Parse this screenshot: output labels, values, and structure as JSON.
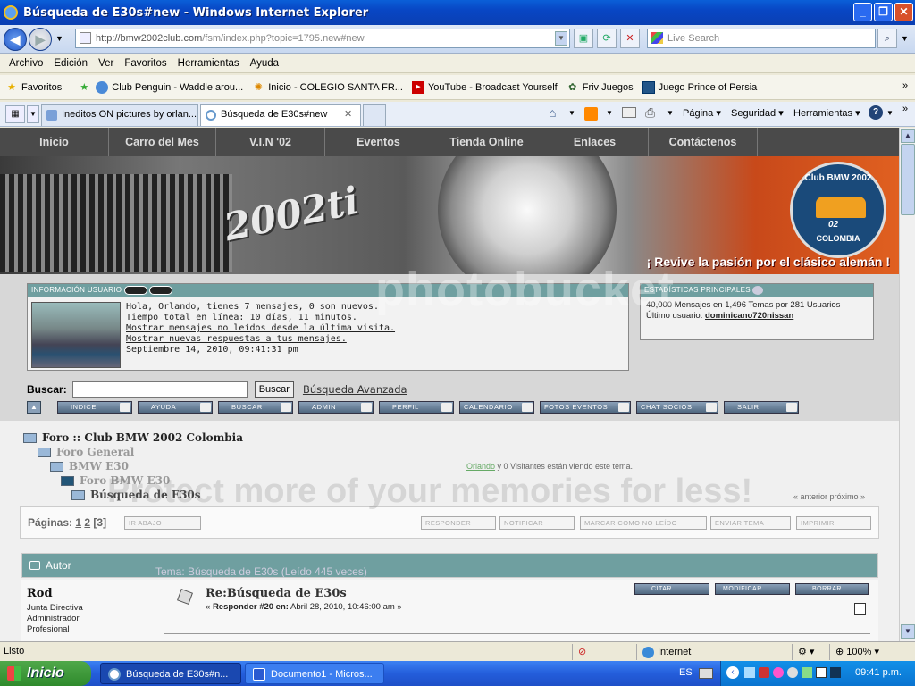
{
  "window": {
    "title": "Búsqueda de E30s#new - Windows Internet Explorer",
    "min": "_",
    "max": "❐",
    "close": "✕"
  },
  "address": {
    "url_prefix": "http://bmw2002club.com",
    "url_path": "/fsm/index.php?topic=1795.new#new",
    "live_search_placeholder": "Live Search"
  },
  "menu": [
    "Archivo",
    "Edición",
    "Ver",
    "Favoritos",
    "Herramientas",
    "Ayuda"
  ],
  "favorites": {
    "label": "Favoritos",
    "items": [
      {
        "label": "Club Penguin - Waddle arou...",
        "icon": "penguin-icon"
      },
      {
        "label": "Inicio - COLEGIO SANTA FR...",
        "icon": "star-icon"
      },
      {
        "label": "YouTube - Broadcast Yourself",
        "icon": "youtube-icon"
      },
      {
        "label": "Friv Juegos",
        "icon": "friv-icon"
      },
      {
        "label": "Juego Prince of Persia",
        "icon": "page-icon"
      }
    ]
  },
  "tabs": [
    {
      "label": "Ineditos ON pictures by orlan..."
    },
    {
      "label": "Búsqueda de E30s#new"
    }
  ],
  "commandbar": [
    "Página",
    "Seguridad",
    "Herramientas"
  ],
  "site_nav": [
    "Inicio",
    "Carro del Mes",
    "V.I.N '02",
    "Eventos",
    "Tienda Online",
    "Enlaces",
    "Contáctenos"
  ],
  "banner": {
    "model": "2002ti",
    "slogan": "¡ Revive la pasión por el clásico alemán !",
    "logo_top": "Club BMW 2002",
    "logo_bottom": "COLOMBIA",
    "logo_badge": "02"
  },
  "user_panel": {
    "header": "INFORMACIÓN USUARIO",
    "line1": "Hola, Orlando, tienes 7 mensajes, 0 son nuevos.",
    "line2": "Tiempo total en línea: 10 días, 11 minutos.",
    "line3": "Mostrar mensajes no leídos desde la última visita.",
    "line4": "Mostrar nuevas respuestas a tus mensajes.",
    "line5": "Septiembre 14, 2010, 09:41:31 pm"
  },
  "stats_panel": {
    "header": "ESTADÍSTICAS PRINCIPALES",
    "line1": "40,000 Mensajes en 1,496 Temas por 281 Usuarios",
    "line2_prefix": "Último usuario:",
    "line2_user": "dominicano720nissan"
  },
  "search": {
    "label": "Buscar:",
    "button": "Buscar",
    "advanced": "Búsqueda Avanzada"
  },
  "action_buttons": [
    "INDICE",
    "AYUDA",
    "BUSCAR",
    "ADMIN",
    "PERFIL",
    "CALENDARIO",
    "FOTOS EVENTOS",
    "CHAT SOCIOS",
    "SALIR"
  ],
  "breadcrumb": [
    "Foro :: Club BMW 2002 Colombia",
    "Foro General",
    "BMW E30",
    "Foro BMW E30",
    "Búsqueda de E30s"
  ],
  "viewing": {
    "user": "Orlando",
    "rest": "y 0 Visitantes están viendo este tema."
  },
  "prev_next": "« anterior próximo »",
  "pages": {
    "label": "Páginas:",
    "p1": "1",
    "p2": "2",
    "current": "[3]",
    "go_down": "IR ABAJO"
  },
  "topic_buttons": [
    "RESPONDER",
    "NOTIFICAR",
    "MARCAR COMO NO LEÍDO",
    "ENVIAR TEMA",
    "IMPRIMIR"
  ],
  "author_bar": {
    "label": "Autor",
    "topic": "Tema: Búsqueda de E30s  (Leído 445 veces)"
  },
  "post": {
    "author": "Rod",
    "roles": [
      "Junta Directiva",
      "Administrador",
      "Profesional"
    ],
    "title": "Re:Búsqueda de E30s",
    "meta_prefix": "« ",
    "meta_bold": "Responder #20 en:",
    "meta_date": " Abril 28, 2010, 10:46:00 am »",
    "buttons": [
      "CITAR",
      "MODIFICAR",
      "BORRAR"
    ]
  },
  "statusbar": {
    "status": "Listo",
    "zone": "Internet",
    "zoom": "100%"
  },
  "taskbar": {
    "start": "Inicio",
    "tasks": [
      "Búsqueda de E30s#n...",
      "Documento1 - Micros..."
    ],
    "lang": "ES",
    "clock": "09:41 p.m."
  },
  "watermark": [
    "photobucket",
    "Protect more of your memories for less!"
  ]
}
